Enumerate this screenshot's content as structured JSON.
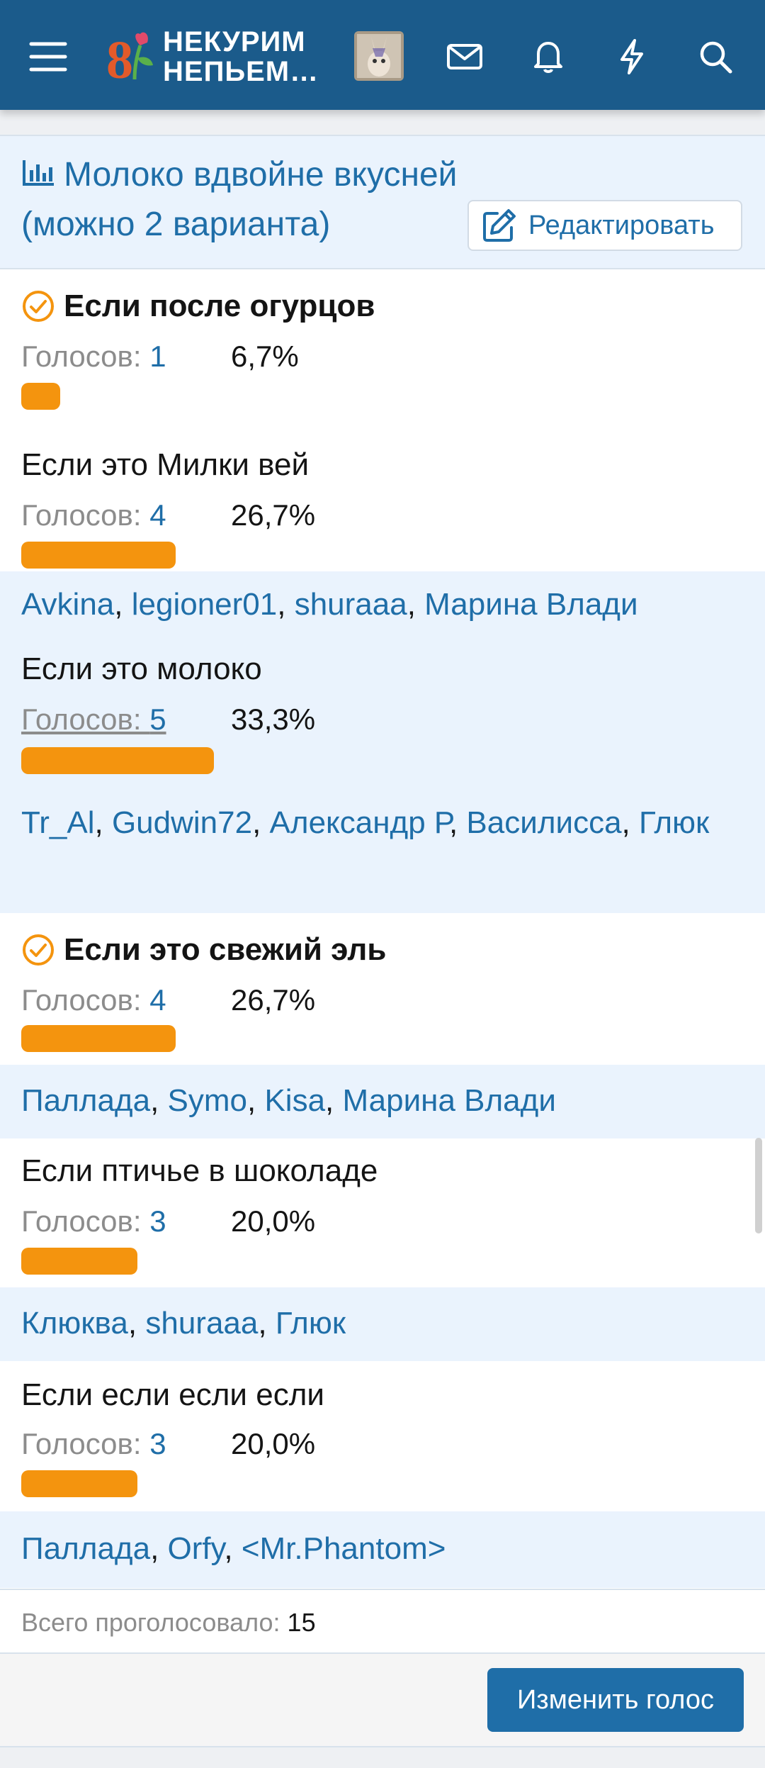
{
  "header": {
    "logo_line1": "НЕКУРИМ",
    "logo_line2": "НЕПЬЕМ…",
    "icons": [
      "menu-icon",
      "avatar",
      "mail-icon",
      "bell-icon",
      "lightning-icon",
      "search-icon"
    ],
    "bar_color": "#1b5b8b"
  },
  "poll": {
    "title": "Молоко вдвойне вкусней (можно 2 варианта)",
    "edit_label": "Редактировать",
    "votes_prefix": "Голосов: ",
    "options": [
      {
        "label": "Если после огурцов",
        "selected": true,
        "votes": "1",
        "percent": "6,7%",
        "fraction": 0.067,
        "voters": []
      },
      {
        "label": "Если это Милки вей",
        "selected": false,
        "votes": "4",
        "percent": "26,7%",
        "fraction": 0.267,
        "voters": [
          "Avkina",
          "legioner01",
          "shuraaa",
          "Марина Влади"
        ]
      },
      {
        "label": "Если это молоко",
        "selected": false,
        "votes": "5",
        "percent": "33,3%",
        "fraction": 0.333,
        "voters": [
          "Tr_Al",
          "Gudwin72",
          "Александр Р",
          "Василисса",
          "Глюк"
        ]
      },
      {
        "label": "Если это свежий эль",
        "selected": true,
        "votes": "4",
        "percent": "26,7%",
        "fraction": 0.267,
        "voters": [
          "Паллада",
          "Symo",
          "Kisa",
          "Марина Влади"
        ]
      },
      {
        "label": "Если птичье в шоколаде",
        "selected": false,
        "votes": "3",
        "percent": "20,0%",
        "fraction": 0.2,
        "voters": [
          "Клюква",
          "shuraaa",
          "Глюк"
        ]
      },
      {
        "label": "Если если если если",
        "selected": false,
        "votes": "3",
        "percent": "20,0%",
        "fraction": 0.2,
        "voters": [
          "Паллада",
          "Orfy",
          "<Mr.Phantom>"
        ]
      }
    ],
    "total_label": "Всего проголосовало: ",
    "total_value": "15",
    "change_vote_label": "Изменить голос"
  },
  "colors": {
    "accent": "#1f6ea8",
    "bar": "#f4940e",
    "voters_bg": "#eaf3fd"
  }
}
